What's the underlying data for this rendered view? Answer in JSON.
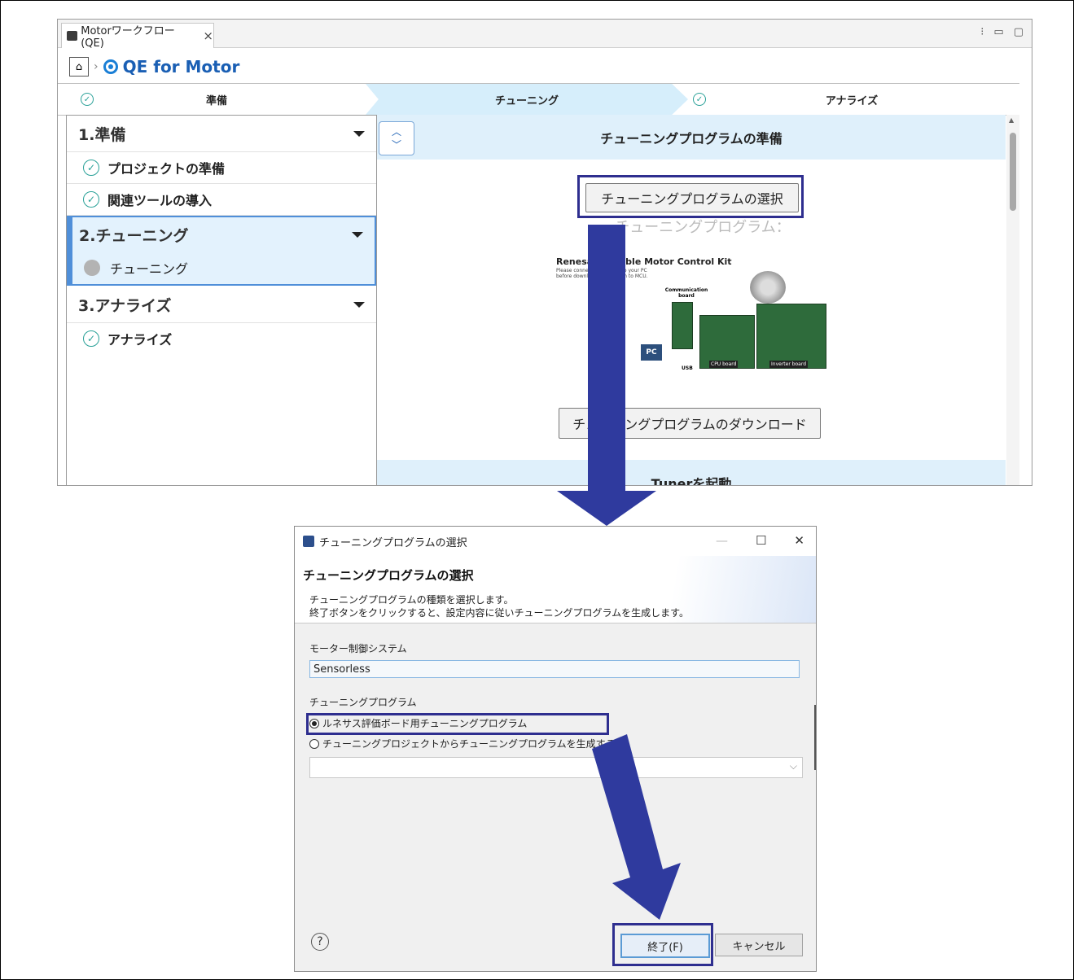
{
  "window": {
    "tab_label": "Motorワークフロー (QE)",
    "tab_close": "×",
    "breadcrumb_title": "QE for Motor",
    "controls": [
      "⁝",
      "▭",
      "▢"
    ]
  },
  "steps": [
    {
      "label": "準備",
      "done": true
    },
    {
      "label": "チューニング",
      "active": true
    },
    {
      "label": "アナライズ",
      "done": true
    }
  ],
  "sidebar": {
    "groups": [
      {
        "label": "1.準備",
        "items": [
          "プロジェクトの準備",
          "関連ツールの導入"
        ]
      },
      {
        "label": "2.チューニング",
        "items": [
          "チューニング"
        ]
      },
      {
        "label": "3.アナライズ",
        "items": [
          "アナライズ"
        ]
      }
    ]
  },
  "main": {
    "section1_title": "チューニングプログラムの準備",
    "select_button": "チューニングプログラムの選択",
    "program_label": "チューニングプログラム：",
    "download_button": "チューニングプログラムのダウンロード",
    "section2_title": "Tunerを起動",
    "kit": {
      "title": "Renesas Flexible Motor Control Kit",
      "note_line1": "Please connect CPU board to your PC",
      "note_line2": "before downloading program to MCU.",
      "comm_label": "Communication board",
      "pc_label": "PC",
      "usb_label": "USB",
      "cpu_label": "CPU board",
      "inverter_label": "Inverter board"
    }
  },
  "dialog": {
    "title": "チューニングプログラムの選択",
    "heading": "チューニングプログラムの選択",
    "desc_line1": "チューニングプログラムの種類を選択します。",
    "desc_line2": "終了ボタンをクリックすると、設定内容に従いチューニングプログラムを生成します。",
    "motor_label": "モーター制御システム",
    "motor_value": "Sensorless",
    "program_label": "チューニングプログラム",
    "radio1": "ルネサス評価ボード用チューニングプログラム",
    "radio2": "チューニングプロジェクトからチューニングプログラムを生成する",
    "finish_button": "終了(F)",
    "cancel_button": "キャンセル",
    "help": "?",
    "ctl_min": "—",
    "ctl_max": "☐",
    "ctl_close": "✕"
  },
  "colors": {
    "accent": "#1a5fb4",
    "highlight_box": "#2e2e8f",
    "arrow": "#2f3a9e",
    "band": "#dff0fb"
  }
}
